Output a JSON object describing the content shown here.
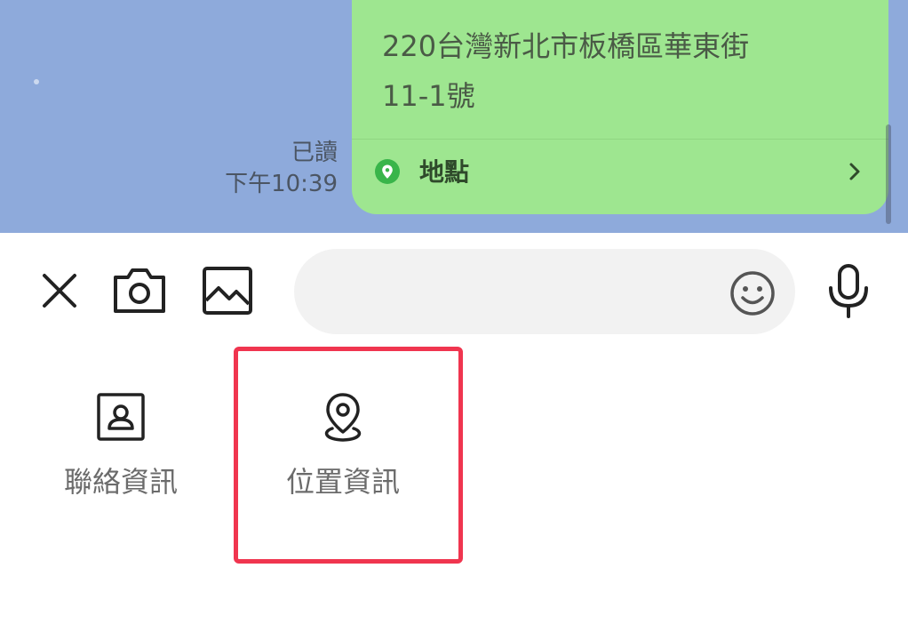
{
  "chat": {
    "read_status": "已讀",
    "timestamp": "下午10:39",
    "location_message": {
      "address_line1": "220台灣新北市板橋區華東街",
      "address_line2": "11-1號",
      "location_label": "地點",
      "pin_icon": "location-pin-icon",
      "chevron_icon": "chevron-right-icon"
    }
  },
  "input_bar": {
    "message_value": "",
    "message_placeholder": "",
    "tools": [
      "close-icon",
      "camera-icon",
      "image-icon",
      "emoji-icon",
      "microphone-icon"
    ]
  },
  "attachments": [
    {
      "label": "聯絡資訊",
      "icon": "contact-card-icon"
    },
    {
      "label": "位置資訊",
      "icon": "location-pin-icon",
      "highlighted": true
    }
  ],
  "colors": {
    "chat_background": "#8eaadb",
    "bubble_green": "#9ee690",
    "highlight_red": "#f0354f",
    "pin_green": "#39b54a"
  }
}
